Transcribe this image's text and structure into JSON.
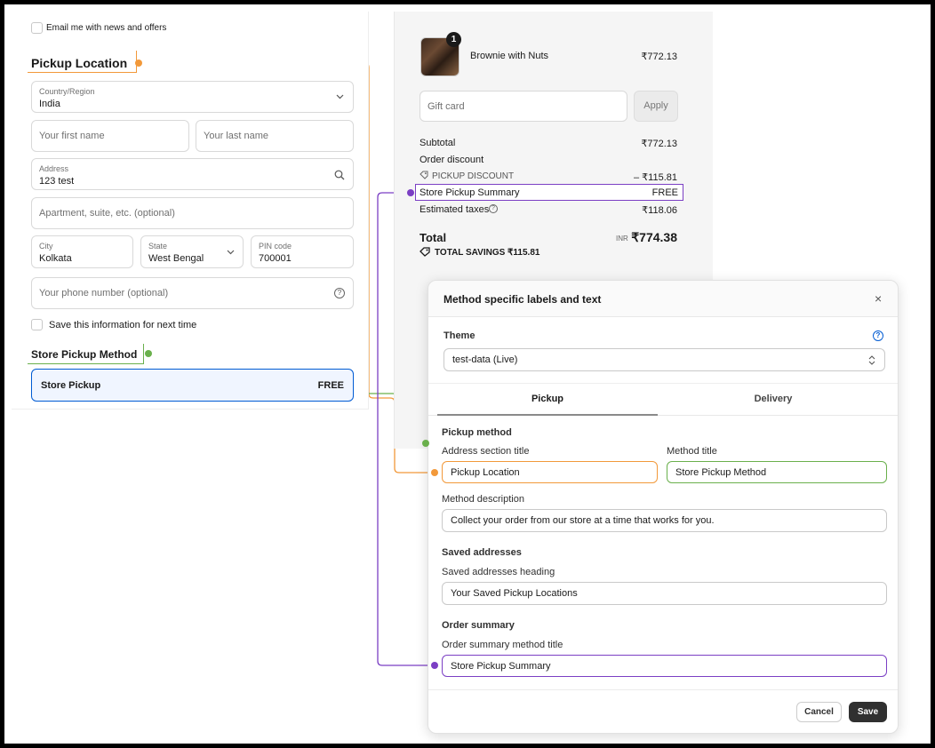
{
  "checkout": {
    "email_optin_label": "Email me with news and offers",
    "pickup_location_heading": "Pickup Location",
    "country": {
      "label": "Country/Region",
      "value": "India"
    },
    "first_name_placeholder": "Your first name",
    "last_name_placeholder": "Your last name",
    "address": {
      "label": "Address",
      "value": "123 test"
    },
    "apartment_placeholder": "Apartment, suite, etc. (optional)",
    "city": {
      "label": "City",
      "value": "Kolkata"
    },
    "state": {
      "label": "State",
      "value": "West Bengal"
    },
    "pin": {
      "label": "PIN code",
      "value": "700001"
    },
    "phone_placeholder": "Your phone number (optional)",
    "save_info_label": "Save this information for next time",
    "store_pickup_heading": "Store Pickup Method",
    "method_option": {
      "name": "Store Pickup",
      "price": "FREE"
    }
  },
  "order_summary": {
    "product": {
      "name": "Brownie with Nuts",
      "price": "₹772.13",
      "quantity": "1"
    },
    "gift_card_placeholder": "Gift card",
    "apply_label": "Apply",
    "subtotal": {
      "label": "Subtotal",
      "value": "₹772.13"
    },
    "order_discount_label": "Order discount",
    "pickup_discount": {
      "label": "PICKUP DISCOUNT",
      "value": "– ₹115.81"
    },
    "shipping_line": {
      "label": "Store Pickup Summary",
      "value": "FREE"
    },
    "taxes": {
      "label": "Estimated taxes",
      "value": "₹118.06"
    },
    "total": {
      "label": "Total",
      "currency": "INR",
      "value": "₹774.38"
    },
    "total_savings": "TOTAL SAVINGS  ₹115.81"
  },
  "modal": {
    "title": "Method specific labels and text",
    "theme_label": "Theme",
    "theme_value": "test-data (Live)",
    "tabs": [
      {
        "label": "Pickup"
      },
      {
        "label": "Delivery"
      }
    ],
    "pickup_method_heading": "Pickup method",
    "address_section_title": {
      "label": "Address section title",
      "value": "Pickup Location"
    },
    "method_title": {
      "label": "Method title",
      "value": "Store Pickup Method"
    },
    "method_description": {
      "label": "Method description",
      "value": "Collect your order from our store at a time that works for you."
    },
    "saved_addresses_heading": "Saved addresses",
    "saved_addresses_field": {
      "label": "Saved addresses heading",
      "value": "Your Saved Pickup Locations"
    },
    "order_summary_heading": "Order summary",
    "order_summary_field": {
      "label": "Order summary method title",
      "value": "Store Pickup Summary"
    },
    "cancel_label": "Cancel",
    "save_label": "Save"
  },
  "colors": {
    "orange": "#f2993a",
    "green": "#6ab04c",
    "purple": "#7b3fc4",
    "accent": "#005bd3"
  }
}
